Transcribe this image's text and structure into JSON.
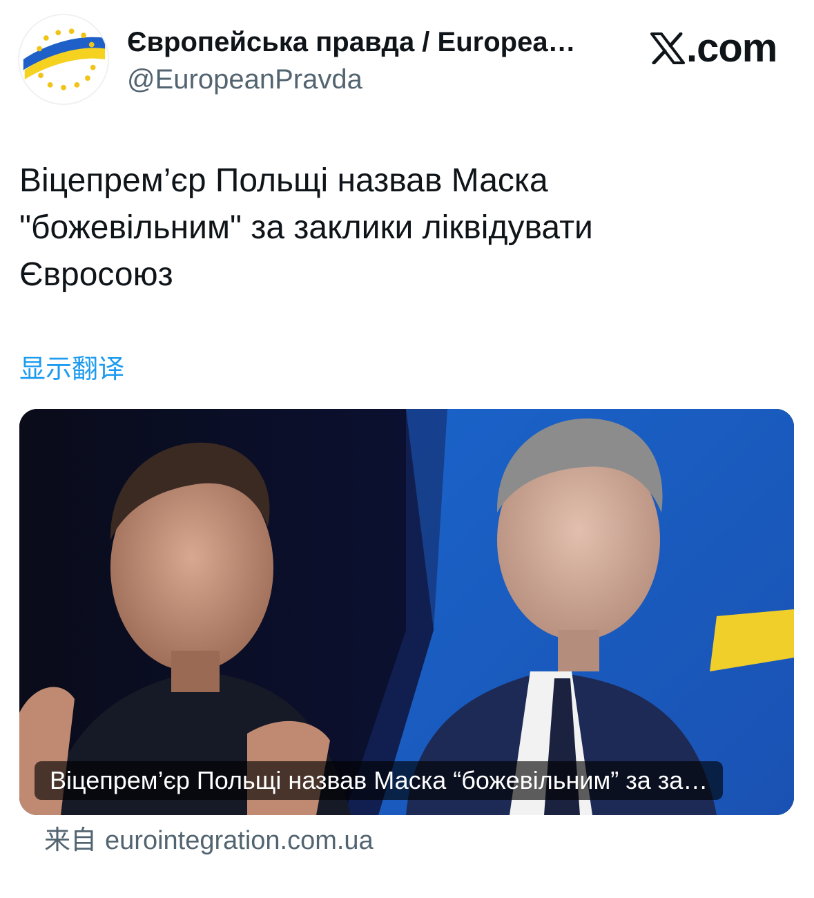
{
  "author": {
    "name": "Європейська правда / Europea…",
    "handle": "@EuropeanPravda",
    "avatar_icon": "european-pravda-logo-icon"
  },
  "brand": {
    "logo_icon": "x-logo-icon",
    "text": ".com"
  },
  "tweet": {
    "text_line_1": "Віцепрем’єр Польщі назвав Маска",
    "text_line_2": "\"божевільним\" за заклики ліквідувати",
    "text_line_3": "Євросоюз",
    "translate_label": "显示翻译"
  },
  "card": {
    "caption": "Віцепрем’єр Польщі назвав Маска “божевільним” за за…",
    "source_prefix": "来自",
    "source_domain": "eurointegration.com.ua"
  },
  "colors": {
    "link": "#1d9bf0",
    "secondary_text": "#536471",
    "primary_text": "#0f1419",
    "flag_blue": "#1f5fc8",
    "flag_yellow": "#f4d21f"
  }
}
